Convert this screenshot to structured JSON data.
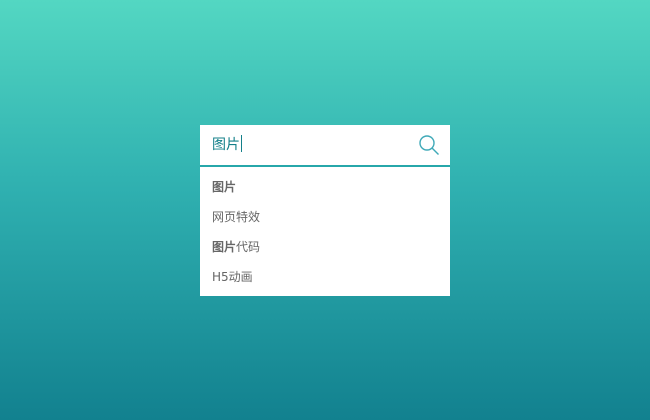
{
  "search": {
    "value": "图片",
    "icon": "search-icon",
    "accent": "#27a7aa"
  },
  "suggestions": [
    {
      "bold": "图片",
      "rest": ""
    },
    {
      "bold": "",
      "rest": "网页特效"
    },
    {
      "bold": "图片",
      "rest": "代码"
    },
    {
      "bold": "",
      "rest": "H5动画"
    }
  ]
}
